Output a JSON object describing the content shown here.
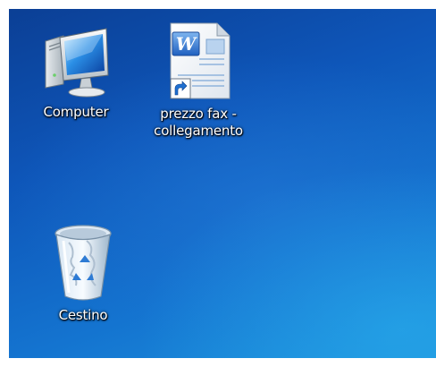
{
  "desktop": {
    "icons": [
      {
        "label": "Computer",
        "icon": "computer-icon"
      },
      {
        "label": "prezzo fax -\ncollegamento",
        "icon": "word-document-shortcut-icon"
      },
      {
        "label": "Cestino",
        "icon": "recycle-bin-icon"
      }
    ]
  },
  "colors": {
    "desktop_dark": "#0b3f95",
    "desktop_light": "#1d92dd",
    "label_text": "#ffffff"
  }
}
